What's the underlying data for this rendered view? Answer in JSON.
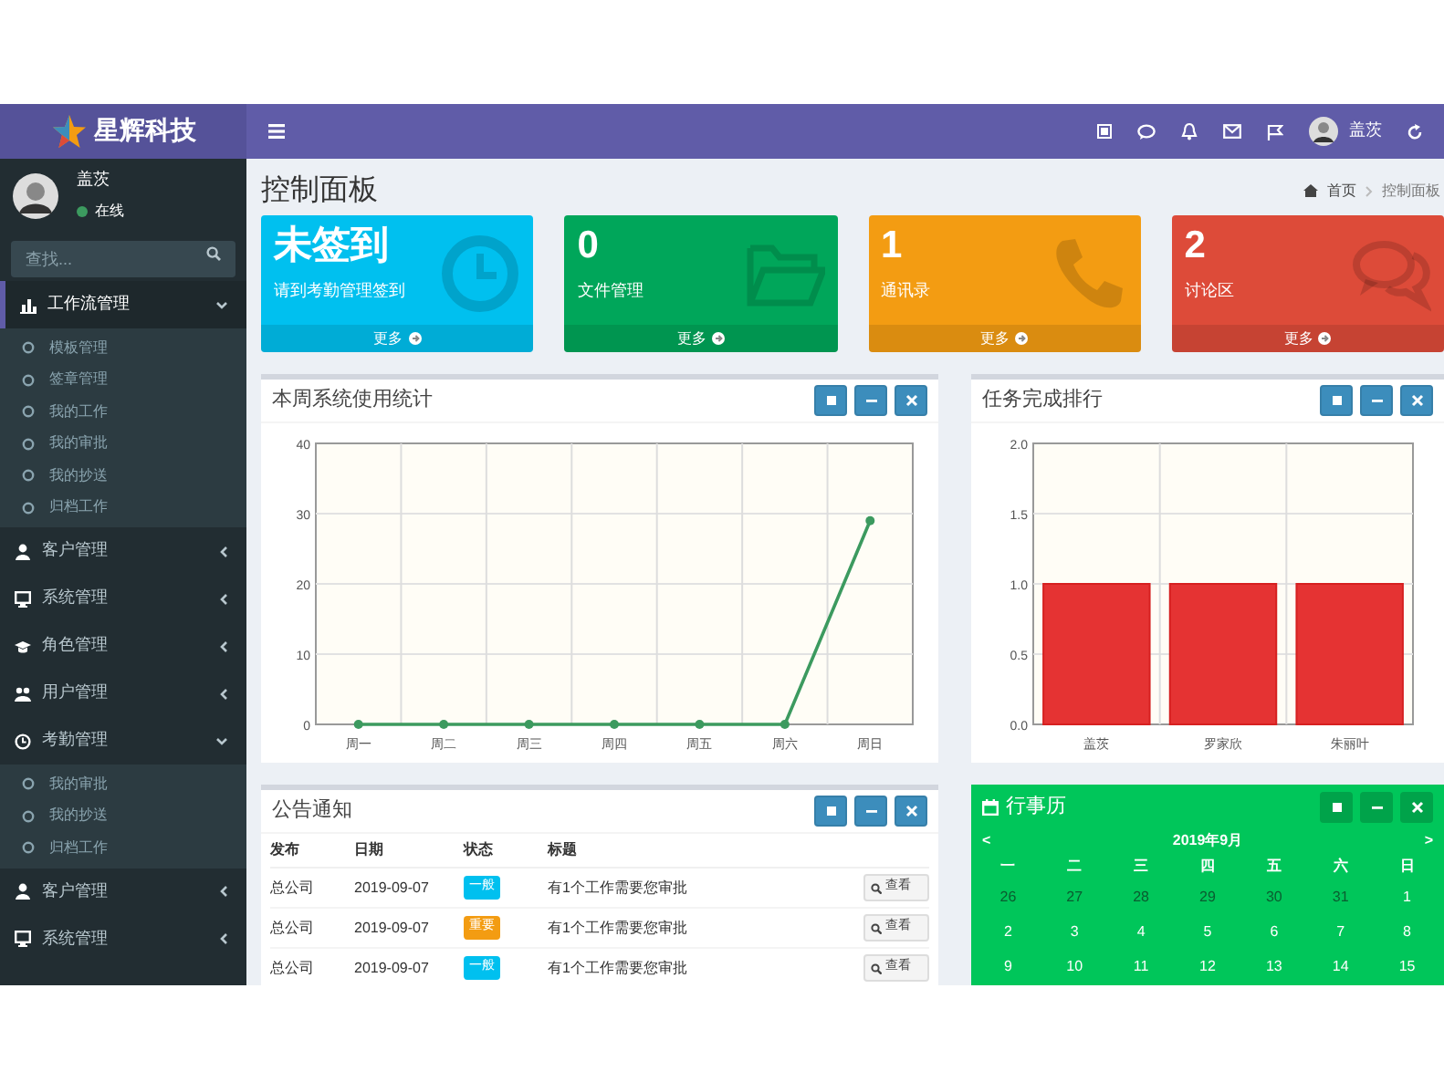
{
  "header": {
    "logo_text": "星辉科技",
    "user_name": "盖茨"
  },
  "sidebar": {
    "user": {
      "name": "盖茨",
      "status": "在线"
    },
    "search": {
      "placeholder": "查找..."
    },
    "menu": [
      {
        "label": "工作流管理",
        "selected": true,
        "expanded": true,
        "children": [
          {
            "label": "模板管理"
          },
          {
            "label": "签章管理"
          },
          {
            "label": "我的工作"
          },
          {
            "label": "我的审批"
          },
          {
            "label": "我的抄送"
          },
          {
            "label": "归档工作"
          }
        ]
      },
      {
        "label": "客户管理",
        "selected": false,
        "expanded": false
      },
      {
        "label": "系统管理",
        "selected": false,
        "expanded": false
      },
      {
        "label": "角色管理",
        "selected": false,
        "expanded": false
      },
      {
        "label": "用户管理",
        "selected": false,
        "expanded": false
      },
      {
        "label": "考勤管理",
        "selected": false,
        "expanded": true,
        "children": [
          {
            "label": "我的审批"
          },
          {
            "label": "我的抄送"
          },
          {
            "label": "归档工作"
          }
        ]
      },
      {
        "label": "客户管理",
        "selected": false,
        "expanded": false
      },
      {
        "label": "系统管理",
        "selected": false,
        "expanded": false
      }
    ]
  },
  "page": {
    "title": "控制面板",
    "breadcrumb": [
      "首页",
      "控制面板"
    ]
  },
  "stat_boxes": [
    {
      "value": "未签到",
      "label": "请到考勤管理签到",
      "link": "更多",
      "color": "#00c0ef"
    },
    {
      "value": "0",
      "label": "文件管理",
      "link": "更多",
      "color": "#00a65a"
    },
    {
      "value": "1",
      "label": "通讯录",
      "link": "更多",
      "color": "#f39c12"
    },
    {
      "value": "2",
      "label": "讨论区",
      "link": "更多",
      "color": "#dd4b39"
    }
  ],
  "usage_panel": {
    "title": "本周系统使用统计",
    "chart_data": {
      "type": "line",
      "categories": [
        "周一",
        "周二",
        "周三",
        "周四",
        "周五",
        "周六",
        "周日"
      ],
      "series": [
        {
          "color": "#3c9a5f",
          "marker": true,
          "values": [
            0,
            0,
            0,
            0,
            0,
            0,
            29
          ]
        }
      ],
      "grid": true,
      "ylim": [
        0,
        40
      ],
      "yticks": [
        0,
        10,
        20,
        30,
        40
      ]
    }
  },
  "ranking_panel": {
    "title": "任务完成排行",
    "chart_data": {
      "type": "bar",
      "categories": [
        "盖茨",
        "罗家欣",
        "朱丽叶"
      ],
      "series": [
        {
          "color": "#e53333",
          "values": [
            1,
            1,
            1
          ]
        }
      ],
      "grid": true,
      "ylim": [
        0,
        2
      ],
      "yticks": [
        {
          "value": 0,
          "label": "0.0"
        },
        {
          "value": 0.5,
          "label": "0.5"
        },
        {
          "value": 1,
          "label": "1.0"
        },
        {
          "value": 1.5,
          "label": "1.5"
        },
        {
          "value": 2,
          "label": "2.0"
        }
      ]
    }
  },
  "notice_panel": {
    "title": "公告通知",
    "columns": [
      "发布",
      "日期",
      "状态",
      "标题"
    ],
    "rows": [
      {
        "publisher": "总公司",
        "date": "2019-09-07",
        "status": "一般",
        "color": "#00c0ef",
        "title": "有1个工作需要您审批",
        "action": "查看"
      },
      {
        "publisher": "总公司",
        "date": "2019-09-07",
        "status": "重要",
        "color": "#f39c12",
        "title": "有1个工作需要您审批",
        "action": "查看"
      },
      {
        "publisher": "总公司",
        "date": "2019-09-07",
        "status": "一般",
        "color": "#00c0ef",
        "title": "有1个工作需要您审批",
        "action": "查看"
      }
    ]
  },
  "calendar_panel": {
    "title": "行事历",
    "month": "2019年9月",
    "prev": "<",
    "next": ">",
    "weekdays": [
      "一",
      "二",
      "三",
      "四",
      "五",
      "六",
      "日"
    ],
    "weeks": [
      [
        {
          "day": "26",
          "other_month": true
        },
        {
          "day": "27",
          "other_month": true
        },
        {
          "day": "28",
          "other_month": true
        },
        {
          "day": "29",
          "other_month": true
        },
        {
          "day": "30",
          "other_month": true
        },
        {
          "day": "31",
          "other_month": true
        },
        {
          "day": "1",
          "other_month": false
        }
      ],
      [
        {
          "day": "2",
          "other_month": false
        },
        {
          "day": "3",
          "other_month": false
        },
        {
          "day": "4",
          "other_month": false
        },
        {
          "day": "5",
          "other_month": false
        },
        {
          "day": "6",
          "other_month": false
        },
        {
          "day": "7",
          "other_month": false
        },
        {
          "day": "8",
          "other_month": false
        }
      ],
      [
        {
          "day": "9",
          "other_month": false
        },
        {
          "day": "10",
          "other_month": false
        },
        {
          "day": "11",
          "other_month": false
        },
        {
          "day": "12",
          "other_month": false
        },
        {
          "day": "13",
          "other_month": false
        },
        {
          "day": "14",
          "other_month": false
        },
        {
          "day": "15",
          "other_month": false
        }
      ]
    ]
  }
}
